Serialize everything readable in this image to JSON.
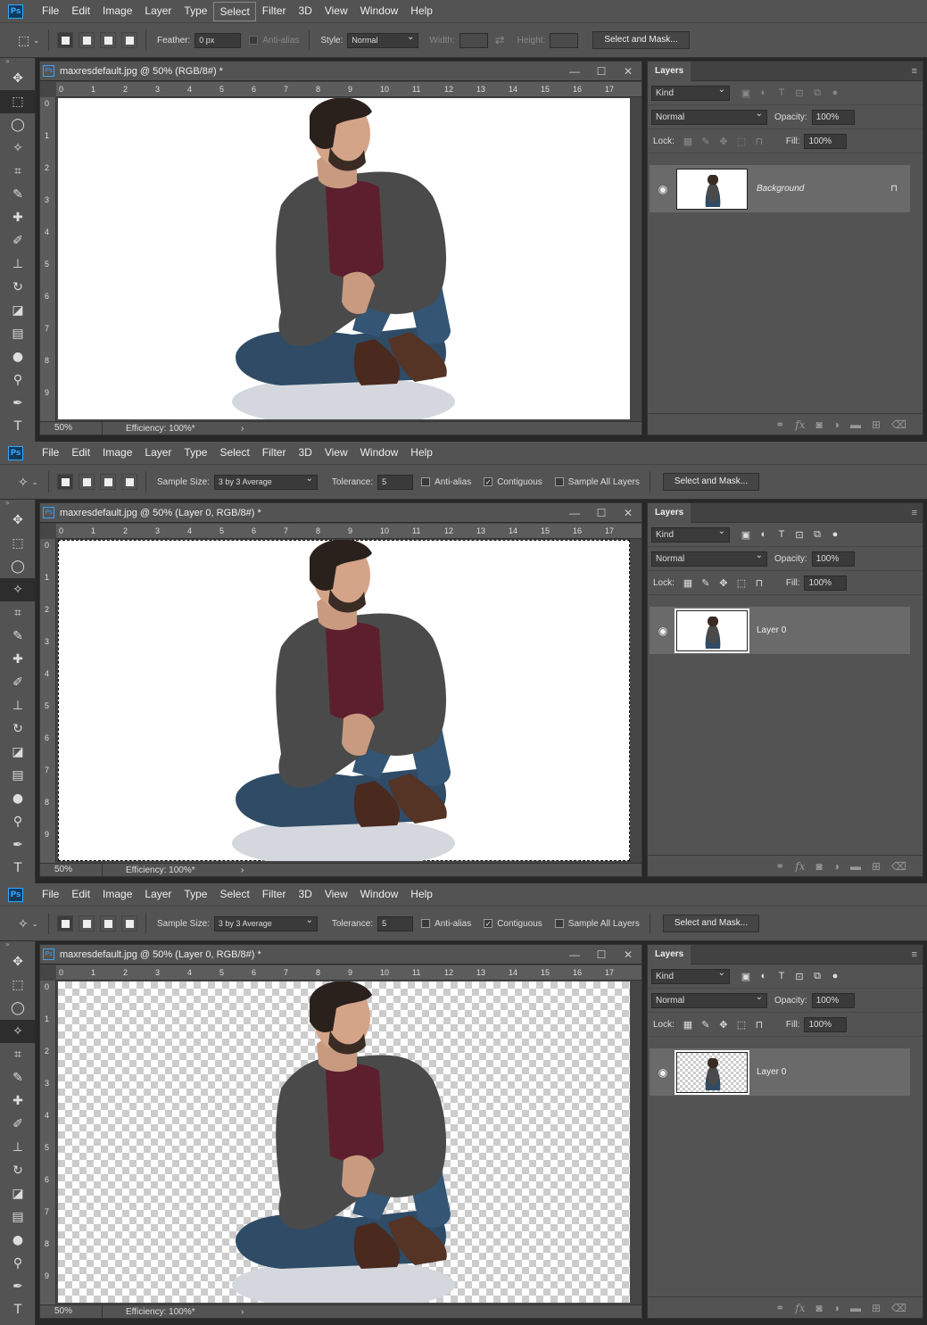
{
  "menu": [
    "File",
    "Edit",
    "Image",
    "Layer",
    "Type",
    "Select",
    "Filter",
    "3D",
    "View",
    "Window",
    "Help"
  ],
  "app_logo": "Ps",
  "panels": [
    {
      "active_menu": "Select",
      "options": {
        "mode": "marquee",
        "feather_label": "Feather:",
        "feather_value": "0 px",
        "antialias_label": "Anti-alias",
        "style_label": "Style:",
        "style_value": "Normal",
        "width_label": "Width:",
        "height_label": "Height:",
        "select_mask": "Select and Mask..."
      },
      "doc_title": "maxresdefault.jpg @ 50% (RGB/8#) *",
      "zoom": "50%",
      "efficiency": "Efficiency: 100%*",
      "layers": {
        "tab": "Layers",
        "kind": "Kind",
        "blend": "Normal",
        "opacity_label": "Opacity:",
        "opacity": "100%",
        "lock_label": "Lock:",
        "fill_label": "Fill:",
        "fill": "100%",
        "layer_name": "Background",
        "disabled": true
      }
    },
    {
      "active_menu": "",
      "options": {
        "mode": "wand",
        "sample_label": "Sample Size:",
        "sample_value": "3 by 3 Average",
        "tolerance_label": "Tolerance:",
        "tolerance_value": "5",
        "antialias_label": "Anti-alias",
        "contiguous_label": "Contiguous",
        "sample_all_label": "Sample All Layers",
        "select_mask": "Select and Mask..."
      },
      "doc_title": "maxresdefault.jpg @ 50% (Layer 0, RGB/8#) *",
      "zoom": "50%",
      "efficiency": "Efficiency: 100%*",
      "layers": {
        "tab": "Layers",
        "kind": "Kind",
        "blend": "Normal",
        "opacity_label": "Opacity:",
        "opacity": "100%",
        "lock_label": "Lock:",
        "fill_label": "Fill:",
        "fill": "100%",
        "layer_name": "Layer 0",
        "disabled": false
      }
    },
    {
      "active_menu": "",
      "options": {
        "mode": "wand",
        "sample_label": "Sample Size:",
        "sample_value": "3 by 3 Average",
        "tolerance_label": "Tolerance:",
        "tolerance_value": "5",
        "antialias_label": "Anti-alias",
        "contiguous_label": "Contiguous",
        "sample_all_label": "Sample All Layers",
        "select_mask": "Select and Mask..."
      },
      "doc_title": "maxresdefault.jpg @ 50% (Layer 0, RGB/8#) *",
      "zoom": "50%",
      "efficiency": "Efficiency: 100%*",
      "layers": {
        "tab": "Layers",
        "kind": "Kind",
        "blend": "Normal",
        "opacity_label": "Opacity:",
        "opacity": "100%",
        "lock_label": "Lock:",
        "fill_label": "Fill:",
        "fill": "100%",
        "layer_name": "Layer 0",
        "disabled": false
      }
    }
  ],
  "ruler_h": [
    "0",
    "1",
    "2",
    "3",
    "4",
    "5",
    "6",
    "7",
    "8",
    "9",
    "10",
    "11",
    "12",
    "13",
    "14",
    "15",
    "16",
    "17"
  ],
  "ruler_v": [
    "0",
    "1",
    "2",
    "3",
    "4",
    "5",
    "6",
    "7",
    "8",
    "9"
  ],
  "colors": {
    "ui_bg": "#535353",
    "dark_bg": "#282828",
    "accent": "#31a8ff"
  }
}
